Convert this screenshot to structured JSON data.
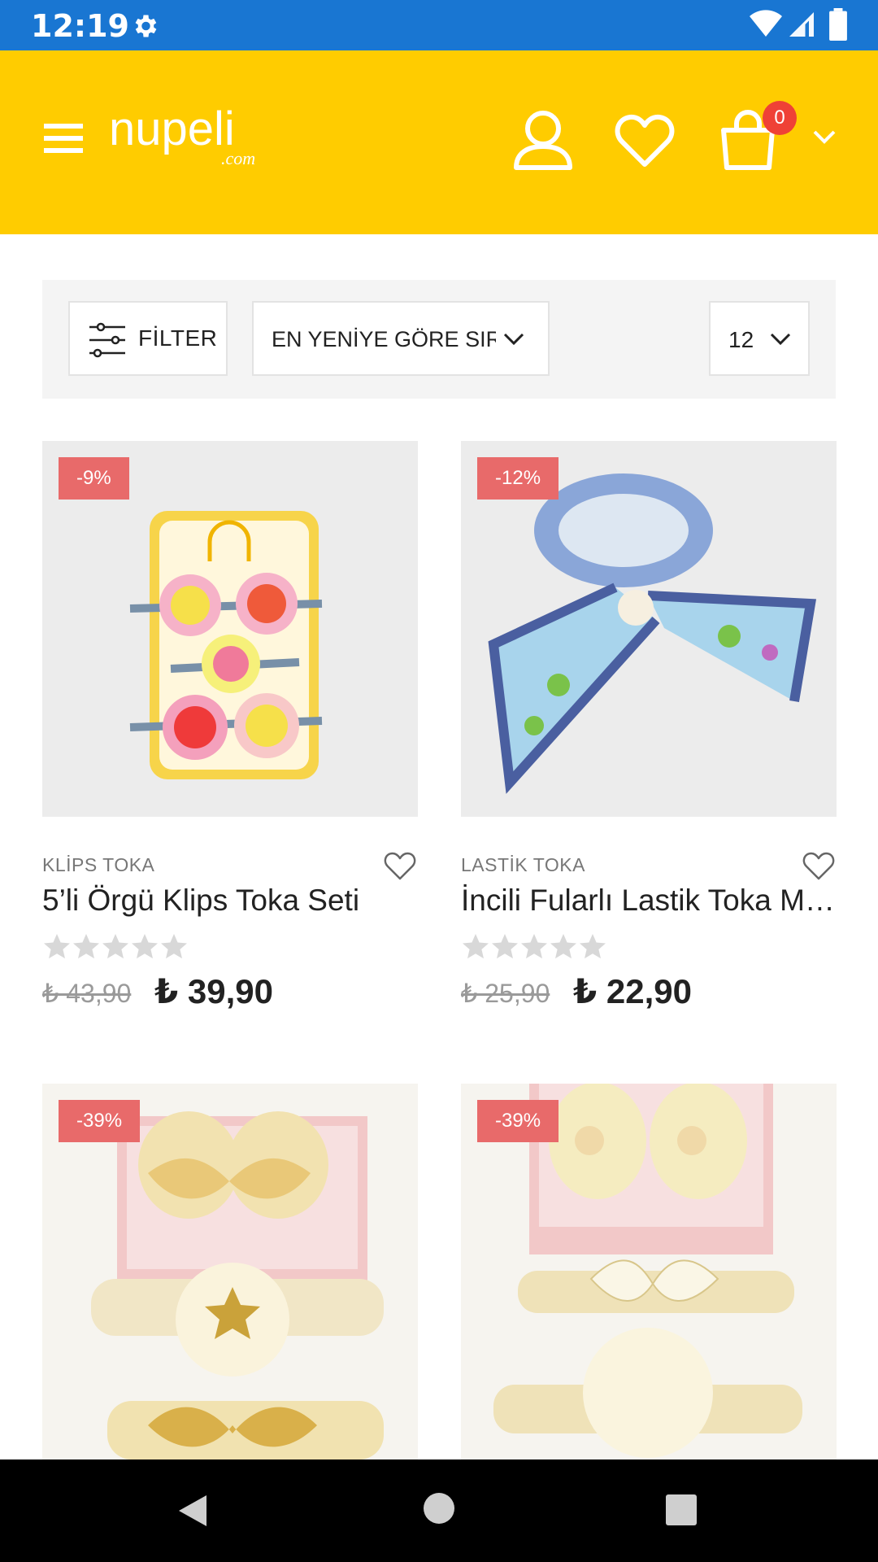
{
  "status_bar": {
    "time": "12:19"
  },
  "header": {
    "logo_text": "nupeli",
    "logo_suffix": ".com",
    "cart_count": "0"
  },
  "toolbar": {
    "filter_label": "FİLTER",
    "sort_value": "EN YENİYE GÖRE SIRALA",
    "per_page_value": "12"
  },
  "products": [
    {
      "discount": "-9%",
      "category": "KLİPS TOKA",
      "title": "5’li Örgü Klips Toka Seti",
      "rating": 0,
      "old_price": "₺ 43,90",
      "new_price": "₺ 39,90"
    },
    {
      "discount": "-12%",
      "category": "LASTİK TOKA",
      "title": "İncili Fularlı Lastik Toka Mavi",
      "rating": 0,
      "old_price": "₺ 25,90",
      "new_price": "₺ 22,90"
    },
    {
      "discount": "-39%"
    },
    {
      "discount": "-39%"
    }
  ],
  "colors": {
    "status_bar": "#1976d2",
    "header": "#ffcc00",
    "badge": "#ef4136",
    "discount": "#e86a6a"
  }
}
